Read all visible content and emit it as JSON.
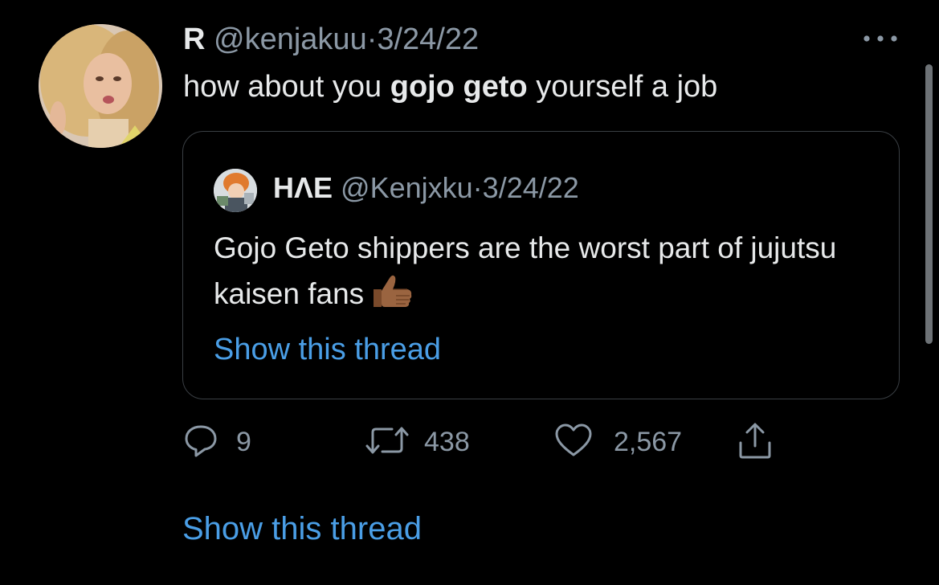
{
  "tweet": {
    "author_name": "R",
    "author_handle": "@kenjakuu",
    "separator": "·",
    "date": "3/24/22",
    "text_before": "how about you ",
    "text_bold": "gojo geto",
    "text_after": " yourself a job",
    "more_icon": "more-horizontal-icon"
  },
  "quote": {
    "author_name": "HΛE",
    "author_handle": "@Kenjxku",
    "separator": "·",
    "date": "3/24/22",
    "text": "Gojo Geto shippers are the worst part of jujutsu kaisen fans",
    "emoji": "thumbs-up-medium-dark-skin-tone",
    "thread_link": "Show this thread"
  },
  "actions": {
    "replies": "9",
    "retweets": "438",
    "likes": "2,567",
    "reply_icon": "reply-icon",
    "retweet_icon": "retweet-icon",
    "like_icon": "heart-icon",
    "share_icon": "share-icon"
  },
  "thread_link": "Show this thread",
  "colors": {
    "background": "#000000",
    "text": "#e7e9ea",
    "muted": "#8b98a5",
    "link": "#4a9ee6",
    "border": "#3a3f44"
  }
}
